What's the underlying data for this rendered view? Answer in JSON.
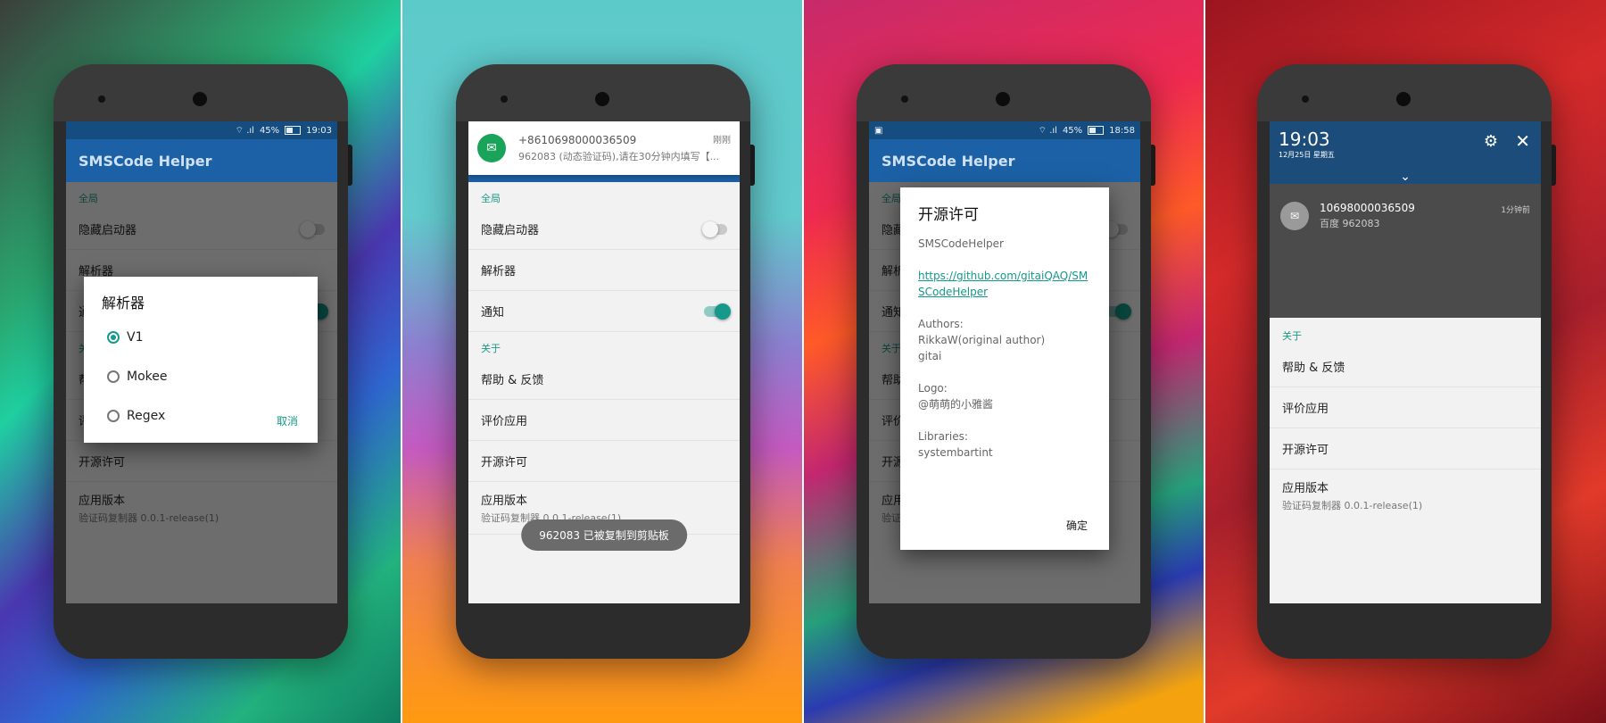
{
  "app": {
    "title": "SMSCode Helper"
  },
  "status": {
    "wifi_signal": "⌔ .ıl",
    "battery_pct": "45%",
    "time1": "19:03",
    "time3": "18:58"
  },
  "settings": {
    "section_global": "全局",
    "hide_launcher": "隐藏启动器",
    "parser": "解析器",
    "notify": "通知",
    "section_about": "关于",
    "help": "帮助 & 反馈",
    "rate": "评价应用",
    "license": "开源许可",
    "version_label": "应用版本",
    "version_value": "验证码复制器 0.0.1-release(1)"
  },
  "parser_dialog": {
    "title": "解析器",
    "options": [
      "V1",
      "Mokee",
      "Regex"
    ],
    "selected": "V1",
    "cancel": "取消"
  },
  "notification": {
    "sender": "+8610698000036509",
    "body": "962083 (动态验证码),请在30分钟内填写【...",
    "time": "刚刚"
  },
  "toast": {
    "text": "962083 已被复制到剪贴板"
  },
  "license_dialog": {
    "title": "开源许可",
    "app_name": "SMSCodeHelper",
    "link": "https://github.com/gitaiQAQ/SMSCodeHelper",
    "authors_label": "Authors:",
    "author1": "RikkaW(original author)",
    "author2": "gitai",
    "logo_label": "Logo:",
    "logo_value": "@萌萌的小雅酱",
    "libs_label": "Libraries:",
    "libs_value": "systembartint",
    "ok": "确定"
  },
  "shade": {
    "clock": "19:03",
    "date": "12月25日 星期五",
    "sender": "10698000036509",
    "body": "百度 962083",
    "time": "1分钟前"
  },
  "colors": {
    "accent": "#14998a",
    "appbar": "#1c61a5",
    "statusbar": "#154d80"
  }
}
